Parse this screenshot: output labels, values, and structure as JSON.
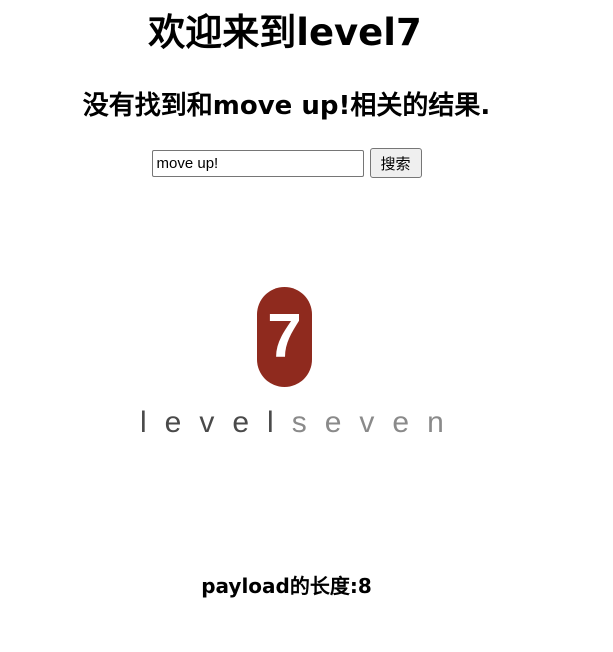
{
  "header": {
    "title": "欢迎来到level7"
  },
  "result": {
    "message": "没有找到和move up!相关的结果."
  },
  "search": {
    "value": "move up!",
    "button_label": "搜索"
  },
  "logo": {
    "digit": "7",
    "word_dark": "level",
    "word_light": "seven",
    "colors": {
      "pill": "#8f2a1e",
      "dark_text": "#4a4a4a",
      "light_text": "#8a8a8a"
    }
  },
  "footer": {
    "payload_length": "payload的长度:8"
  }
}
